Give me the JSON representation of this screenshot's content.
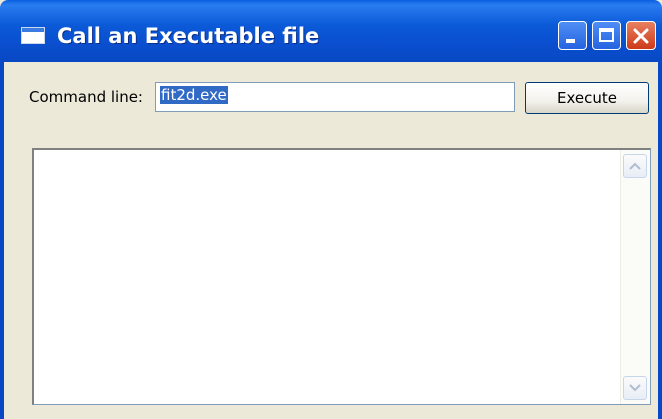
{
  "window": {
    "title": "Call an Executable file"
  },
  "form": {
    "command_label": "Command line:",
    "command_value": "fit2d.exe",
    "execute_label": "Execute"
  },
  "output": {
    "text": ""
  },
  "icons": {
    "app": "app-window-icon",
    "minimize": "minimize-icon",
    "maximize": "maximize-icon",
    "close": "close-icon",
    "scroll_up": "chevron-up-icon",
    "scroll_down": "chevron-down-icon"
  },
  "colors": {
    "titlebar": "#0a5fe0",
    "close_button": "#cc3a18",
    "window_face": "#ece9d8",
    "selection": "#316ac5"
  }
}
